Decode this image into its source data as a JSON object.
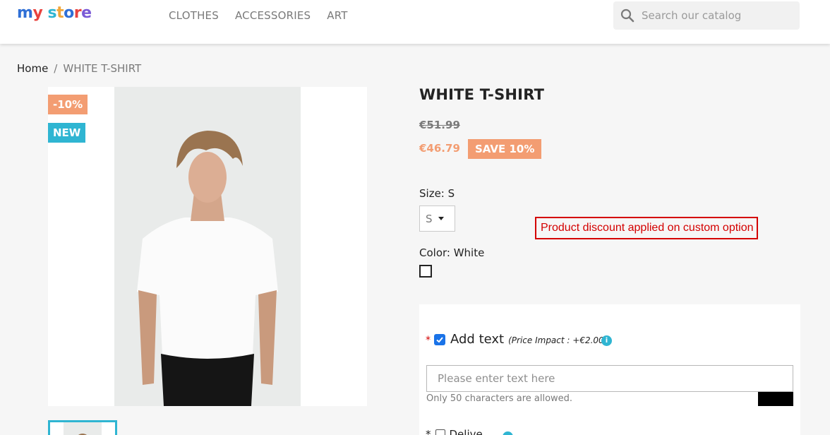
{
  "header": {
    "logo_text": "my store",
    "nav": [
      "CLOTHES",
      "ACCESSORIES",
      "ART"
    ],
    "search_placeholder": "Search our catalog"
  },
  "breadcrumb": {
    "home": "Home",
    "separator": "/",
    "current": "WHITE T-SHIRT"
  },
  "product": {
    "flags": {
      "discount": "-10%",
      "new": "NEW"
    },
    "title": "WHITE T-SHIRT",
    "regular_price": "€51.99",
    "current_price": "€46.79",
    "save_badge": "SAVE 10%",
    "size_label": "Size: S",
    "size_value": "S",
    "color_label": "Color: White",
    "discount_note": "Product discount applied on custom option"
  },
  "customization": {
    "required_marker": "*",
    "option_title": "Add text",
    "price_impact": "(Price Impact : +€2.00)",
    "info_icon": "i",
    "input_placeholder": "Please enter text here",
    "help_text": "Only 50 characters are allowed.",
    "next_option_label": "Delive"
  },
  "colors": {
    "accent": "#2fb5d2",
    "discount": "#f39d72",
    "error": "#d40000"
  }
}
